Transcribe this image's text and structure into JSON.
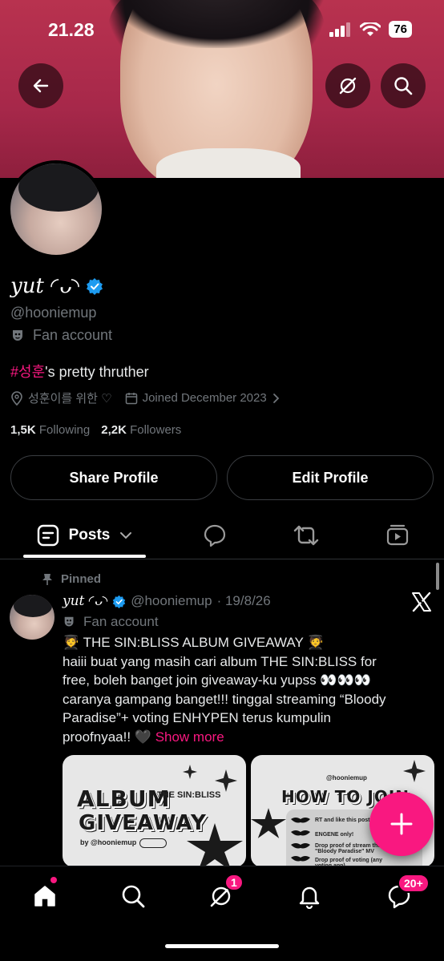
{
  "status_bar": {
    "time": "21.28",
    "battery": "76"
  },
  "profile": {
    "name": "yut ◜ᴗ◝",
    "handle": "@hooniemup",
    "category": "Fan account",
    "bio_tag": "#성훈",
    "bio_rest": "'s pretty thruther",
    "location": "성훈이를 위한 ♡",
    "joined": "Joined December 2023",
    "following_count": "1,5K",
    "following_label": "Following",
    "followers_count": "2,2K",
    "followers_label": "Followers"
  },
  "actions": {
    "share": "Share Profile",
    "edit": "Edit Profile"
  },
  "tabs": {
    "posts": "Posts"
  },
  "post": {
    "pinned_label": "Pinned",
    "name": "yut ◜ᴗ◝",
    "handle": "@hooniemup",
    "date": "· 19/8/26",
    "category": "Fan account",
    "lines": [
      "🧑‍🎓 THE SIN:BLISS ALBUM GIVEAWAY 🧑‍🎓",
      "haiii buat yang masih cari album THE SIN:BLISS for",
      "free, boleh banget join giveaway-ku yupss 👀👀👀",
      "caranya gampang banget!!! tinggal streaming “Bloody",
      "Paradise”+ voting ENHYPEN terus kumpulin"
    ],
    "last_line": "proofnyaa!! 🖤",
    "show_more": "Show more",
    "card1": {
      "title1": "ALBUM",
      "title2": "GIVEAWAY",
      "sub": "THE SIN:BLISS",
      "by": "by @hooniemup"
    },
    "card2": {
      "handle": "@hooniemup",
      "title": "HOW TO JOIN",
      "steps": [
        "RT and like this post",
        "ENGENE only!",
        "Drop proof of stream the \"Bloody Paradise\" MV",
        "Drop proof of voting (any voting app)"
      ]
    }
  },
  "nav": {
    "messages_badge": "1",
    "dm_badge": "20+"
  },
  "colors": {
    "accent": "#f91880",
    "verified": "#1d9bf0",
    "muted": "#71767b"
  }
}
